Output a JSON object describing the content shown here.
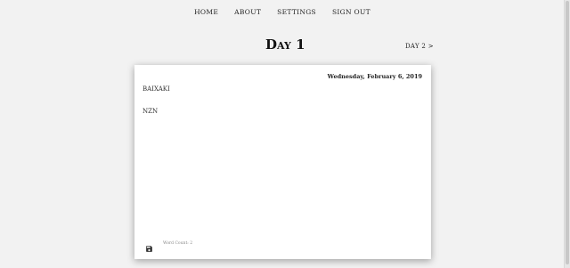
{
  "nav": {
    "items": [
      {
        "label": "HOME"
      },
      {
        "label": "ABOUT"
      },
      {
        "label": "SETTINGS"
      },
      {
        "label": "SIGN OUT"
      }
    ]
  },
  "header": {
    "title": "Day 1",
    "next_link": "DAY 2 >"
  },
  "entry": {
    "date": "Wednesday, February 6, 2019",
    "lines": [
      "BAIXAKI",
      "NZN"
    ],
    "word_count": "Word Count: 2"
  },
  "icons": {
    "save": "floppy-disk-icon"
  }
}
